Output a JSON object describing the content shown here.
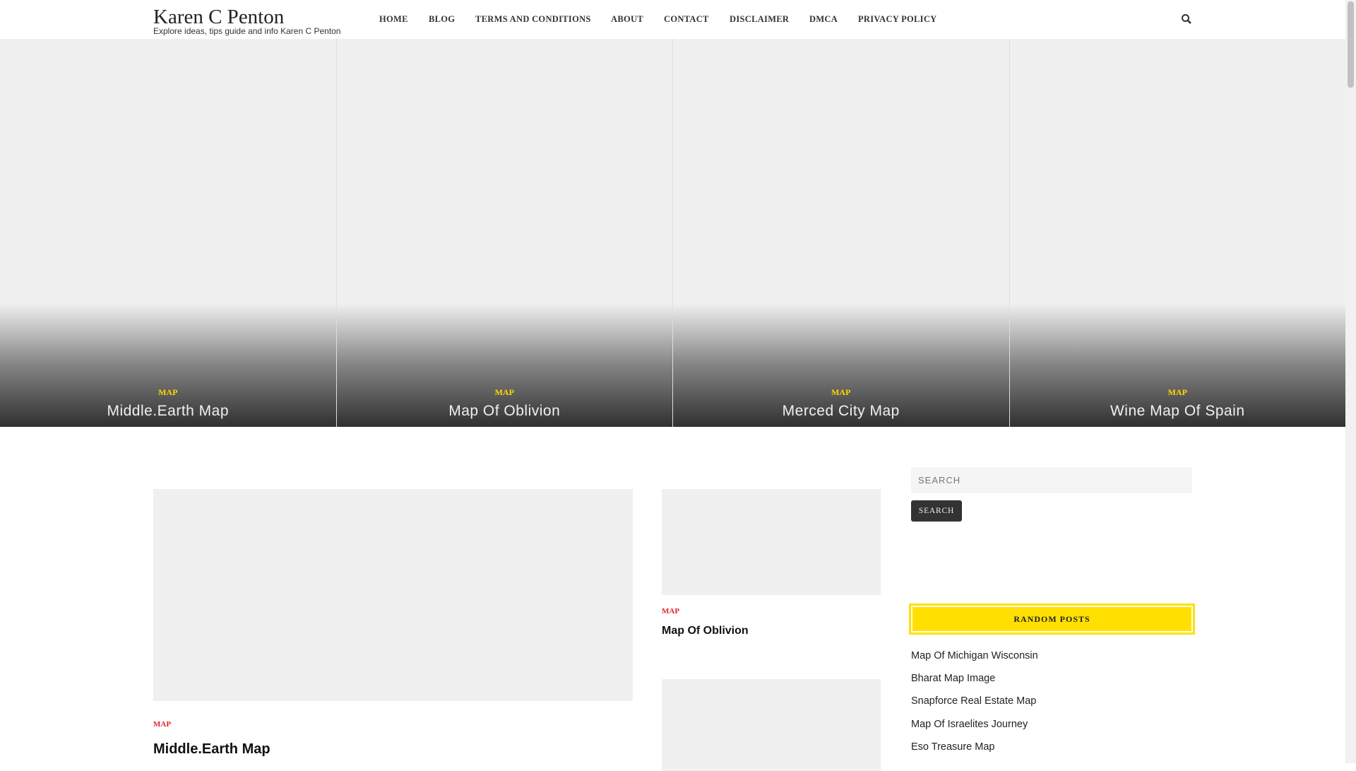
{
  "site": {
    "title": "Karen C Penton",
    "tagline": "Explore ideas, tips guide and info Karen C Penton"
  },
  "nav": [
    "HOME",
    "BLOG",
    "TERMS AND CONDITIONS",
    "ABOUT",
    "CONTACT",
    "DISCLAIMER",
    "DMCA",
    "PRIVACY POLICY"
  ],
  "hero": [
    {
      "category": "MAP",
      "title": "Middle.Earth Map"
    },
    {
      "category": "MAP",
      "title": "Map Of Oblivion"
    },
    {
      "category": "MAP",
      "title": "Merced City Map"
    },
    {
      "category": "MAP",
      "title": "Wine Map Of Spain"
    }
  ],
  "posts": [
    {
      "category": "MAP",
      "title": "Middle.Earth Map"
    },
    {
      "category": "MAP",
      "title": "Map Of Oblivion"
    }
  ],
  "sidebar": {
    "search_placeholder": "SEARCH",
    "search_button": "SEARCH",
    "random_title": "RANDOM POSTS",
    "random_posts": [
      "Map Of Michigan Wisconsin",
      "Bharat Map Image",
      "Snapforce Real Estate Map",
      "Map Of Israelites Journey",
      "Eso Treasure Map"
    ]
  }
}
